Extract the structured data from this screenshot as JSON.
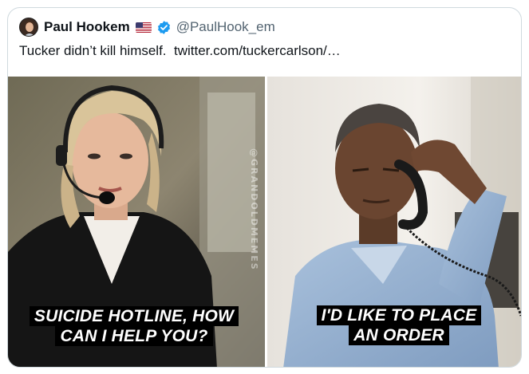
{
  "tweet": {
    "author_name": "Paul Hookem",
    "handle": "@PaulHook_em",
    "text": "Tucker didn’t kill himself.",
    "link_text": "twitter.com/tuckercarlson/…"
  },
  "meme": {
    "left_caption_line1": "SUICIDE HOTLINE, HOW",
    "left_caption_line2": "CAN I HELP YOU?",
    "right_caption_line1": "I'D LIKE TO PLACE",
    "right_caption_line2": "AN ORDER",
    "watermark": "@GRANDOLDMEMES"
  },
  "colors": {
    "verified_badge": "#1d9bf0",
    "handle_text": "#536471",
    "card_border": "#cfd9de"
  },
  "icons": {
    "flag": "us-flag-icon",
    "verified": "verified-badge-icon"
  }
}
